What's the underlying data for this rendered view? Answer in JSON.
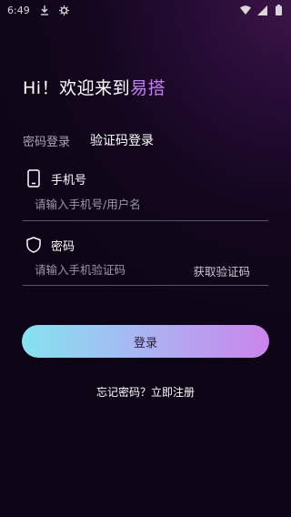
{
  "status_bar": {
    "time": "6:49"
  },
  "header": {
    "greeting": "Hi！欢迎来到",
    "brand": "易搭"
  },
  "tabs": [
    {
      "label": "密码登录"
    },
    {
      "label": "验证码登录"
    }
  ],
  "phone_field": {
    "label": "手机号",
    "placeholder": "请输入手机号/用户名",
    "icon": "phone-icon"
  },
  "code_field": {
    "label": "密码",
    "placeholder": "请输入手机验证码",
    "icon": "shield-icon",
    "get_code_label": "获取验证码"
  },
  "login_button": {
    "label": "登录"
  },
  "footer": {
    "forgot": "忘记密码？",
    "register": "立即注册"
  },
  "colors": {
    "brand": "#c57ef0",
    "button_start": "#86e2f0",
    "button_end": "#cb84ec"
  }
}
